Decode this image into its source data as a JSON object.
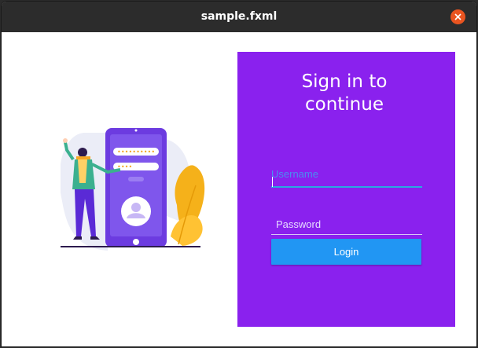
{
  "window": {
    "title": "sample.fxml"
  },
  "panel": {
    "heading_line1": "Sign in to",
    "heading_line2": "continue",
    "background": "#8a21ee"
  },
  "form": {
    "username_label": "Username",
    "username_value": "",
    "password_placeholder": "Password",
    "login_label": "Login",
    "button_color": "#2196f3"
  }
}
